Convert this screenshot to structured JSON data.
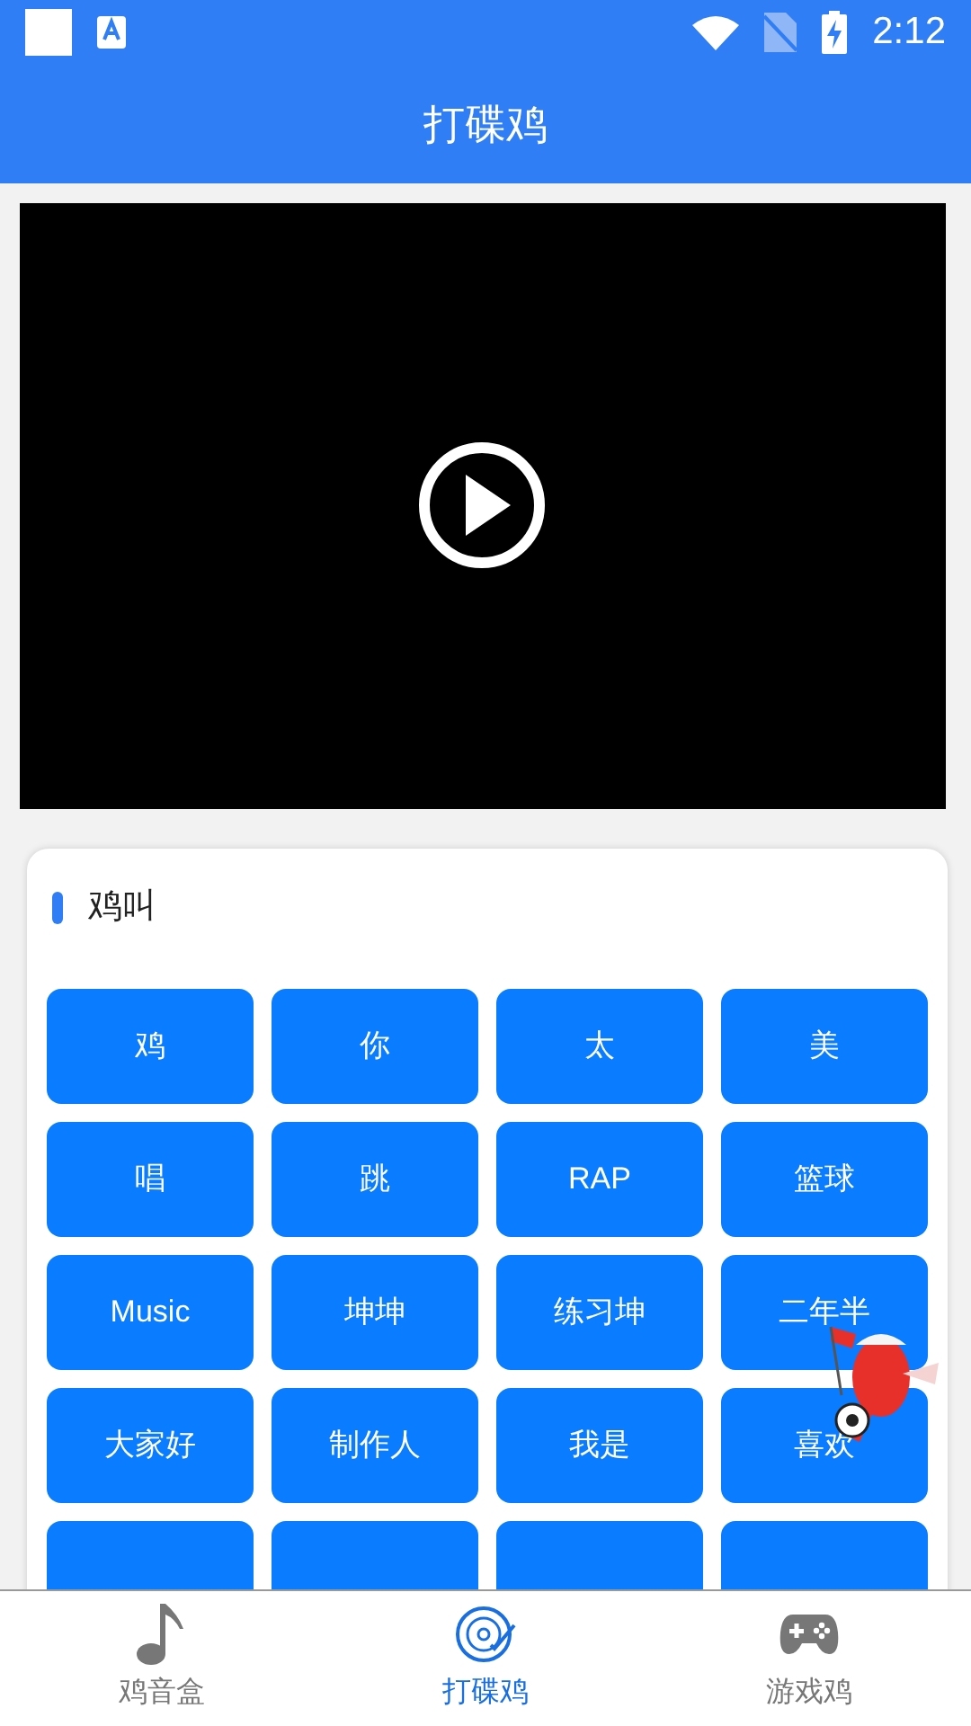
{
  "status_bar": {
    "time": "2:12"
  },
  "app_bar": {
    "title": "打碟鸡"
  },
  "section": {
    "title": "鸡叫",
    "buttons": [
      {
        "kind": "labeled",
        "label": "鸡"
      },
      {
        "kind": "labeled",
        "label": "你"
      },
      {
        "kind": "labeled",
        "label": "太"
      },
      {
        "kind": "labeled",
        "label": "美"
      },
      {
        "kind": "labeled",
        "label": "唱"
      },
      {
        "kind": "labeled",
        "label": "跳"
      },
      {
        "kind": "labeled",
        "label": "RAP"
      },
      {
        "kind": "labeled",
        "label": "篮球"
      },
      {
        "kind": "labeled",
        "label": "Music"
      },
      {
        "kind": "labeled",
        "label": "坤坤"
      },
      {
        "kind": "labeled",
        "label": "练习坤"
      },
      {
        "kind": "labeled",
        "label": "二年半"
      },
      {
        "kind": "labeled",
        "label": "大家好"
      },
      {
        "kind": "labeled",
        "label": "制作人"
      },
      {
        "kind": "labeled",
        "label": "我是"
      },
      {
        "kind": "labeled",
        "label": "喜欢"
      },
      {
        "kind": "cut_off"
      },
      {
        "kind": "cut_off"
      },
      {
        "kind": "cut_off"
      },
      {
        "kind": "cut_off"
      }
    ]
  },
  "bottom_nav": [
    {
      "label": "鸡音盒",
      "kind": "note",
      "selected": false
    },
    {
      "label": "打碟鸡",
      "kind": "disc",
      "selected": true
    },
    {
      "label": "游戏鸡",
      "kind": "gamepad",
      "selected": false
    }
  ]
}
